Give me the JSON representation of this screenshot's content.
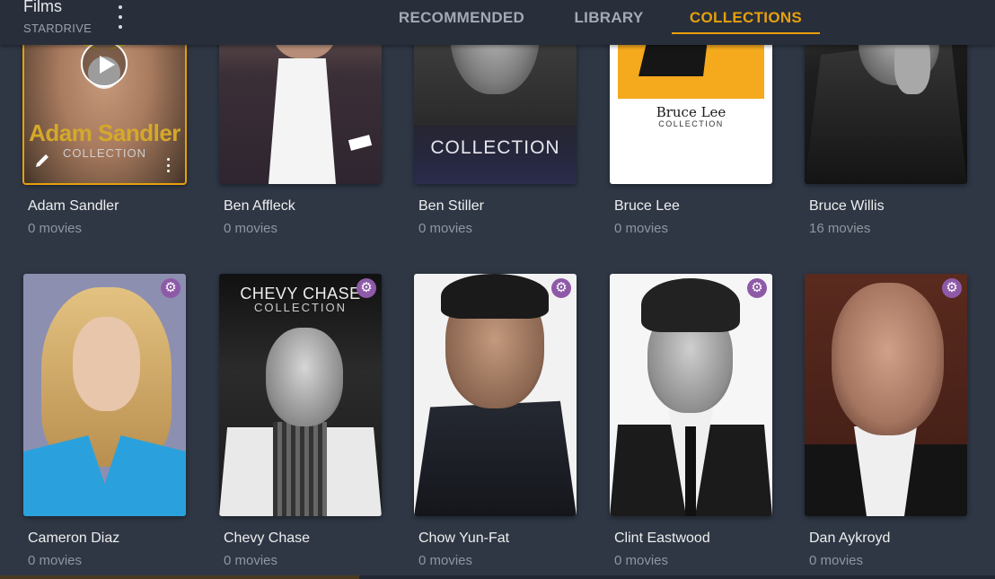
{
  "header": {
    "title": "Films",
    "subtitle": "STARDRIVE",
    "menu_icon": "kebab-menu-icon",
    "tabs": [
      {
        "label": "RECOMMENDED",
        "active": false
      },
      {
        "label": "LIBRARY",
        "active": false
      },
      {
        "label": "COLLECTIONS",
        "active": true
      }
    ]
  },
  "colors": {
    "accent": "#e5a00d",
    "background": "#2f3745",
    "header_background": "#282f3b",
    "badge": "#8e5aa8"
  },
  "collections": [
    {
      "name": "Adam Sandler",
      "count": "0 movies",
      "poster_text": "Adam Sandler",
      "poster_subtext": "COLLECTION",
      "selected": true
    },
    {
      "name": "Ben Affleck",
      "count": "0 movies"
    },
    {
      "name": "Ben Stiller",
      "count": "0 movies",
      "poster_text": "COLLECTION"
    },
    {
      "name": "Bruce Lee",
      "count": "0 movies",
      "poster_text": "Bruce Lee",
      "poster_subtext": "COLLECTION"
    },
    {
      "name": "Bruce Willis",
      "count": "16 movies"
    },
    {
      "name": "Cameron Diaz",
      "count": "0 movies"
    },
    {
      "name": "Chevy Chase",
      "count": "0 movies",
      "poster_text": "CHEVY CHASE",
      "poster_subtext": "COLLECTION"
    },
    {
      "name": "Chow Yun-Fat",
      "count": "0 movies"
    },
    {
      "name": "Clint Eastwood",
      "count": "0 movies"
    },
    {
      "name": "Dan Aykroyd",
      "count": "0 movies"
    }
  ],
  "icons": {
    "play": "play-icon",
    "edit": "pencil-icon",
    "more": "more-vertical-icon",
    "settings_badge": "gear-icon",
    "settings_glyph": "⚙"
  }
}
